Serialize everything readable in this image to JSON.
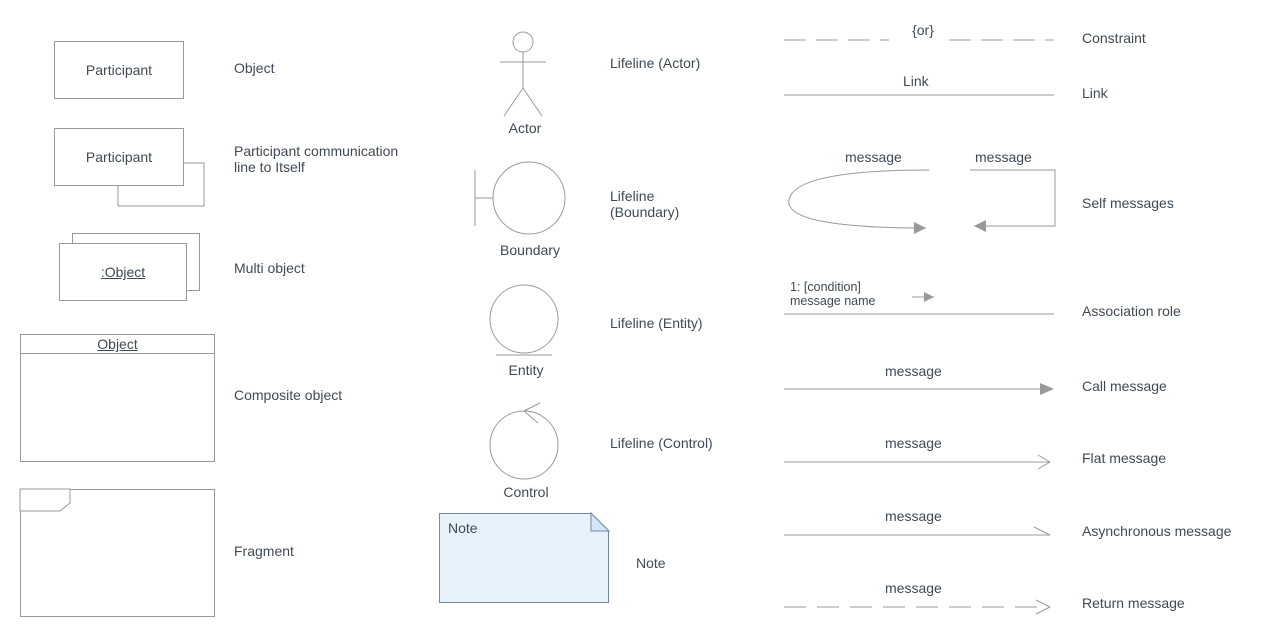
{
  "col1": {
    "participant": {
      "boxLabel": "Participant",
      "desc": "Object"
    },
    "participantComm": {
      "boxLabel": "Participant",
      "desc": "Participant communication\nline to Itself"
    },
    "multi": {
      "boxLabel": ":Object",
      "desc": "Multi object"
    },
    "composite": {
      "header": "Object",
      "desc": "Composite object"
    },
    "fragment": {
      "desc": "Fragment"
    }
  },
  "col2": {
    "actor": {
      "caption": "Actor",
      "desc": "Lifeline (Actor)"
    },
    "boundary": {
      "caption": "Boundary",
      "desc": "Lifeline\n(Boundary)"
    },
    "entity": {
      "caption": "Entity",
      "desc": "Lifeline (Entity)"
    },
    "control": {
      "caption": "Control",
      "desc": "Lifeline (Control)"
    },
    "note": {
      "label": "Note",
      "desc": "Note"
    }
  },
  "col3": {
    "constraint": {
      "text": "{or}",
      "desc": "Constraint"
    },
    "link": {
      "text": "Link",
      "desc": "Link"
    },
    "self": {
      "msg1": "message",
      "msg2": "message",
      "desc": "Self messages"
    },
    "assoc": {
      "text": "1: [condition]\nmessage name",
      "desc": "Association role"
    },
    "call": {
      "text": "message",
      "desc": "Call message"
    },
    "flat": {
      "text": "message",
      "desc": "Flat message"
    },
    "async": {
      "text": "message",
      "desc": "Asynchronous message"
    },
    "ret": {
      "text": "message",
      "desc": "Return message"
    }
  }
}
